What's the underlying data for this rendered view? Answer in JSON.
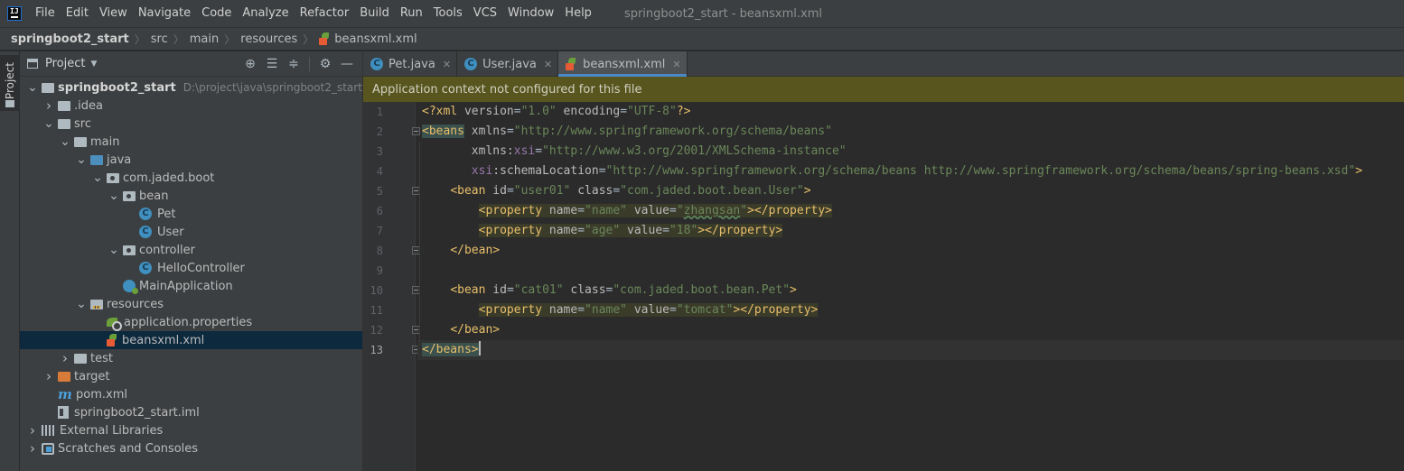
{
  "menubar": {
    "items": [
      "File",
      "Edit",
      "View",
      "Navigate",
      "Code",
      "Analyze",
      "Refactor",
      "Build",
      "Run",
      "Tools",
      "VCS",
      "Window",
      "Help"
    ],
    "window_title": "springboot2_start - beansxml.xml"
  },
  "breadcrumb": [
    "springboot2_start",
    "src",
    "main",
    "resources",
    "beansxml.xml"
  ],
  "left_stripe": {
    "project_label": "Project"
  },
  "project_panel": {
    "title": "Project",
    "tools": [
      "locate-icon",
      "expand-all-icon",
      "collapse-all-icon",
      "gear-icon",
      "minimize-icon"
    ],
    "tree": [
      {
        "label": "springboot2_start",
        "path": "D:\\project\\java\\springboot2_start",
        "icon": "folder",
        "expanded": true,
        "bold": true
      },
      {
        "label": ".idea",
        "icon": "folder",
        "expanded": false
      },
      {
        "label": "src",
        "icon": "folder",
        "expanded": true
      },
      {
        "label": "main",
        "icon": "folder",
        "expanded": true
      },
      {
        "label": "java",
        "icon": "source-folder",
        "expanded": true
      },
      {
        "label": "com.jaded.boot",
        "icon": "package",
        "expanded": true
      },
      {
        "label": "bean",
        "icon": "package",
        "expanded": true
      },
      {
        "label": "Pet",
        "icon": "class"
      },
      {
        "label": "User",
        "icon": "class"
      },
      {
        "label": "controller",
        "icon": "package",
        "expanded": true
      },
      {
        "label": "HelloController",
        "icon": "class"
      },
      {
        "label": "MainApplication",
        "icon": "spring-app"
      },
      {
        "label": "resources",
        "icon": "resources-folder",
        "expanded": true
      },
      {
        "label": "application.properties",
        "icon": "properties"
      },
      {
        "label": "beansxml.xml",
        "icon": "spring-xml",
        "selected": true
      },
      {
        "label": "test",
        "icon": "folder",
        "expanded": false
      },
      {
        "label": "target",
        "icon": "excluded-folder",
        "expanded": false
      },
      {
        "label": "pom.xml",
        "icon": "maven"
      },
      {
        "label": "springboot2_start.iml",
        "icon": "iml"
      },
      {
        "label": "External Libraries",
        "icon": "libraries",
        "expanded": false
      },
      {
        "label": "Scratches and Consoles",
        "icon": "scratches",
        "expanded": false
      }
    ]
  },
  "editor_tabs": [
    {
      "label": "Pet.java",
      "icon": "class",
      "active": false
    },
    {
      "label": "User.java",
      "icon": "class",
      "active": false
    },
    {
      "label": "beansxml.xml",
      "icon": "spring-xml",
      "active": true
    }
  ],
  "banner": {
    "text": "Application context not configured for this file"
  },
  "editor": {
    "line_numbers": [
      "1",
      "2",
      "3",
      "4",
      "5",
      "6",
      "7",
      "8",
      "9",
      "10",
      "11",
      "12",
      "13"
    ],
    "current_line": "13",
    "lines": [
      [
        {
          "t": "<?xml ",
          "c": "pi"
        },
        {
          "t": "version",
          "c": "attr"
        },
        {
          "t": "=",
          "c": "text"
        },
        {
          "t": "\"1.0\"",
          "c": "val"
        },
        {
          "t": " encoding",
          "c": "attr"
        },
        {
          "t": "=",
          "c": "text"
        },
        {
          "t": "\"UTF-8\"",
          "c": "val"
        },
        {
          "t": "?>",
          "c": "pi"
        }
      ],
      [
        {
          "t": "<beans",
          "c": "tag",
          "hl": "match"
        },
        {
          "t": " xmlns",
          "c": "attr"
        },
        {
          "t": "=",
          "c": "text"
        },
        {
          "t": "\"http://www.springframework.org/schema/beans\"",
          "c": "val"
        }
      ],
      [
        {
          "t": "       xmlns",
          "c": "attr"
        },
        {
          "t": ":",
          "c": "text"
        },
        {
          "t": "xsi",
          "c": "ns"
        },
        {
          "t": "=",
          "c": "text"
        },
        {
          "t": "\"http://www.w3.org/2001/XMLSchema-instance\"",
          "c": "val"
        }
      ],
      [
        {
          "t": "       ",
          "c": "text"
        },
        {
          "t": "xsi",
          "c": "ns"
        },
        {
          "t": ":schemaLocation",
          "c": "attr"
        },
        {
          "t": "=",
          "c": "text"
        },
        {
          "t": "\"http://www.springframework.org/schema/beans http://www.springframework.org/schema/beans/spring-beans.xsd\"",
          "c": "val"
        },
        {
          "t": ">",
          "c": "tag"
        }
      ],
      [
        {
          "t": "    ",
          "c": "text"
        },
        {
          "t": "<bean ",
          "c": "tag"
        },
        {
          "t": "id",
          "c": "attr"
        },
        {
          "t": "=",
          "c": "text"
        },
        {
          "t": "\"user01\"",
          "c": "val"
        },
        {
          "t": " class",
          "c": "attr"
        },
        {
          "t": "=",
          "c": "text"
        },
        {
          "t": "\"com.jaded.boot.bean.User\"",
          "c": "val"
        },
        {
          "t": ">",
          "c": "tag"
        }
      ],
      [
        {
          "t": "        ",
          "c": "text"
        },
        {
          "t": "<property ",
          "c": "tag",
          "hl": "y"
        },
        {
          "t": "name",
          "c": "attr",
          "hl": "y"
        },
        {
          "t": "=",
          "c": "text",
          "hl": "y"
        },
        {
          "t": "\"name\"",
          "c": "val",
          "hl": "y"
        },
        {
          "t": " value",
          "c": "attr",
          "hl": "y"
        },
        {
          "t": "=",
          "c": "text",
          "hl": "y"
        },
        {
          "t": "\"",
          "c": "val",
          "hl": "y"
        },
        {
          "t": "zhangsan",
          "c": "val",
          "hl": "y",
          "typo": true
        },
        {
          "t": "\"",
          "c": "val",
          "hl": "y"
        },
        {
          "t": "></property>",
          "c": "tag",
          "hl": "y"
        }
      ],
      [
        {
          "t": "        ",
          "c": "text"
        },
        {
          "t": "<property ",
          "c": "tag",
          "hl": "y"
        },
        {
          "t": "name",
          "c": "attr",
          "hl": "y"
        },
        {
          "t": "=",
          "c": "text",
          "hl": "y"
        },
        {
          "t": "\"age\"",
          "c": "val",
          "hl": "y"
        },
        {
          "t": " value",
          "c": "attr",
          "hl": "y"
        },
        {
          "t": "=",
          "c": "text",
          "hl": "y"
        },
        {
          "t": "\"18\"",
          "c": "val",
          "hl": "y"
        },
        {
          "t": "></property>",
          "c": "tag",
          "hl": "y"
        }
      ],
      [
        {
          "t": "    ",
          "c": "text"
        },
        {
          "t": "</bean>",
          "c": "tag"
        }
      ],
      [],
      [
        {
          "t": "    ",
          "c": "text"
        },
        {
          "t": "<bean ",
          "c": "tag"
        },
        {
          "t": "id",
          "c": "attr"
        },
        {
          "t": "=",
          "c": "text"
        },
        {
          "t": "\"cat01\"",
          "c": "val"
        },
        {
          "t": " class",
          "c": "attr"
        },
        {
          "t": "=",
          "c": "text"
        },
        {
          "t": "\"com.jaded.boot.bean.Pet\"",
          "c": "val"
        },
        {
          "t": ">",
          "c": "tag"
        }
      ],
      [
        {
          "t": "        ",
          "c": "text"
        },
        {
          "t": "<property ",
          "c": "tag",
          "hl": "y"
        },
        {
          "t": "name",
          "c": "attr",
          "hl": "y"
        },
        {
          "t": "=",
          "c": "text",
          "hl": "y"
        },
        {
          "t": "\"name\"",
          "c": "val",
          "hl": "y"
        },
        {
          "t": " value",
          "c": "attr",
          "hl": "y"
        },
        {
          "t": "=",
          "c": "text",
          "hl": "y"
        },
        {
          "t": "\"tomcat\"",
          "c": "val",
          "hl": "y"
        },
        {
          "t": "></property>",
          "c": "tag",
          "hl": "y"
        }
      ],
      [
        {
          "t": "    ",
          "c": "text"
        },
        {
          "t": "</bean>",
          "c": "tag"
        }
      ],
      [
        {
          "t": "</beans>",
          "c": "tag",
          "hl": "match"
        }
      ]
    ]
  },
  "colors": {
    "menubar_bg": "#3c3f41",
    "editor_bg": "#2b2b2b",
    "banner_bg": "#58551f",
    "selection_bg": "#0d293e",
    "accent": "#4a88c7",
    "xml_tag": "#e8bf6a",
    "xml_value": "#6a8759",
    "xml_namespace": "#9876aa"
  }
}
